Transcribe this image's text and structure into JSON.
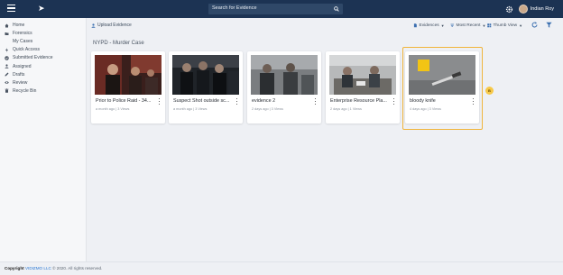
{
  "header": {
    "search_placeholder": "Search for Evidence",
    "user_name": "Indian Roy"
  },
  "sidebar": {
    "items": [
      {
        "label": "Home",
        "icon": "home-icon"
      },
      {
        "label": "Forensics",
        "icon": "folder-icon"
      },
      {
        "label": "My Cases",
        "icon": ""
      },
      {
        "label": "Quick Access",
        "icon": "bolt-icon"
      },
      {
        "label": "Submitted Evidence",
        "icon": "check-icon"
      },
      {
        "label": "Assigned",
        "icon": "user-icon"
      },
      {
        "label": "Drafts",
        "icon": "edit-icon"
      },
      {
        "label": "Review",
        "icon": "eye-icon"
      },
      {
        "label": "Recycle Bin",
        "icon": "trash-icon"
      }
    ]
  },
  "toolbar": {
    "upload_label": "Upload Evidence",
    "filter_label": "Evidences",
    "sort_label": "Most Recent",
    "view_label": "Thumb View"
  },
  "main": {
    "case_title": "NYPD - Murder Case",
    "cards": [
      {
        "title": "Prior to Police Raid - 34...",
        "meta": "a month ago | 3 Views"
      },
      {
        "title": "Suspect Shot outside sc...",
        "meta": "a month ago | 3 Views"
      },
      {
        "title": "evidence 2",
        "meta": "2 days ago | 3 Views"
      },
      {
        "title": "Enterprise Resource Pla...",
        "meta": "2 days ago | 1 Views"
      },
      {
        "title": "bloody knife",
        "meta": "4 days ago | 3 Views"
      }
    ],
    "highlight_badge": "B"
  },
  "footer": {
    "copyright_prefix": "Copyright",
    "brand": "VIDIZMO LLC",
    "suffix": "© 2020. All rights reserved."
  },
  "colors": {
    "topbar": "#1c3353",
    "highlight": "#f0b43a",
    "link": "#2a78d4"
  }
}
